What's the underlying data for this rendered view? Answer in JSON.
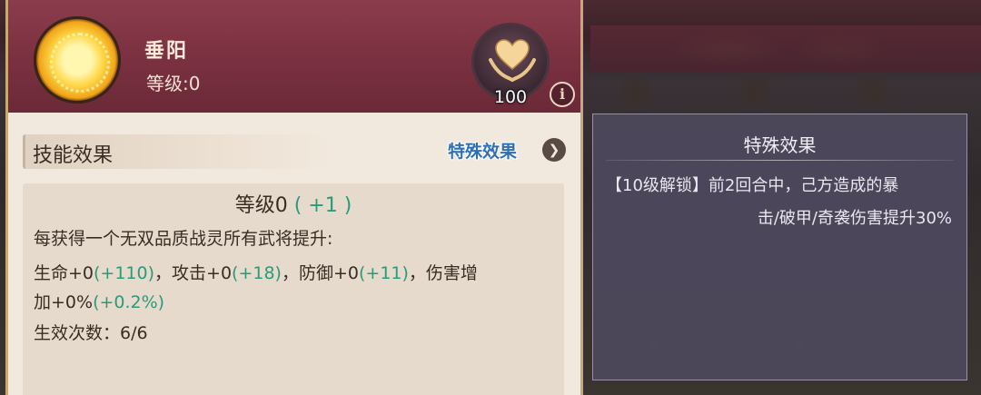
{
  "spirit": {
    "name": "垂阳",
    "level_text": "等级:0",
    "icon": "sun-icon"
  },
  "heart": {
    "icon": "heart-hands-icon",
    "count": "100",
    "info_icon": "i"
  },
  "skill": {
    "section_label": "技能效果",
    "special_link": "特殊效果",
    "special_arrow": "❯",
    "level_label": "等级0",
    "level_bonus": "( +1 )",
    "line1": "每获得一个无双品质战灵所有武将提升:",
    "line2_a": "生命+0",
    "line2_b": "(+110)",
    "line2_c": "，攻击+0",
    "line2_d": "(+18)",
    "line2_e": "，防御+0",
    "line2_f": "(+11)",
    "line2_g": "，伤害增",
    "line3_a": "加+0%",
    "line3_b": "(+0.2%)",
    "line4": "生效次数：6/6"
  },
  "tooltip": {
    "title": "特殊效果",
    "line1": "【10级解锁】前2回合中，己方造成的暴",
    "line2": "击/破甲/奇袭伤害提升30%"
  },
  "colors": {
    "header": "#7a3040",
    "bonus_green": "#2a9a78",
    "link_blue": "#2f6fb5",
    "tooltip_bg": "#4e485c"
  }
}
